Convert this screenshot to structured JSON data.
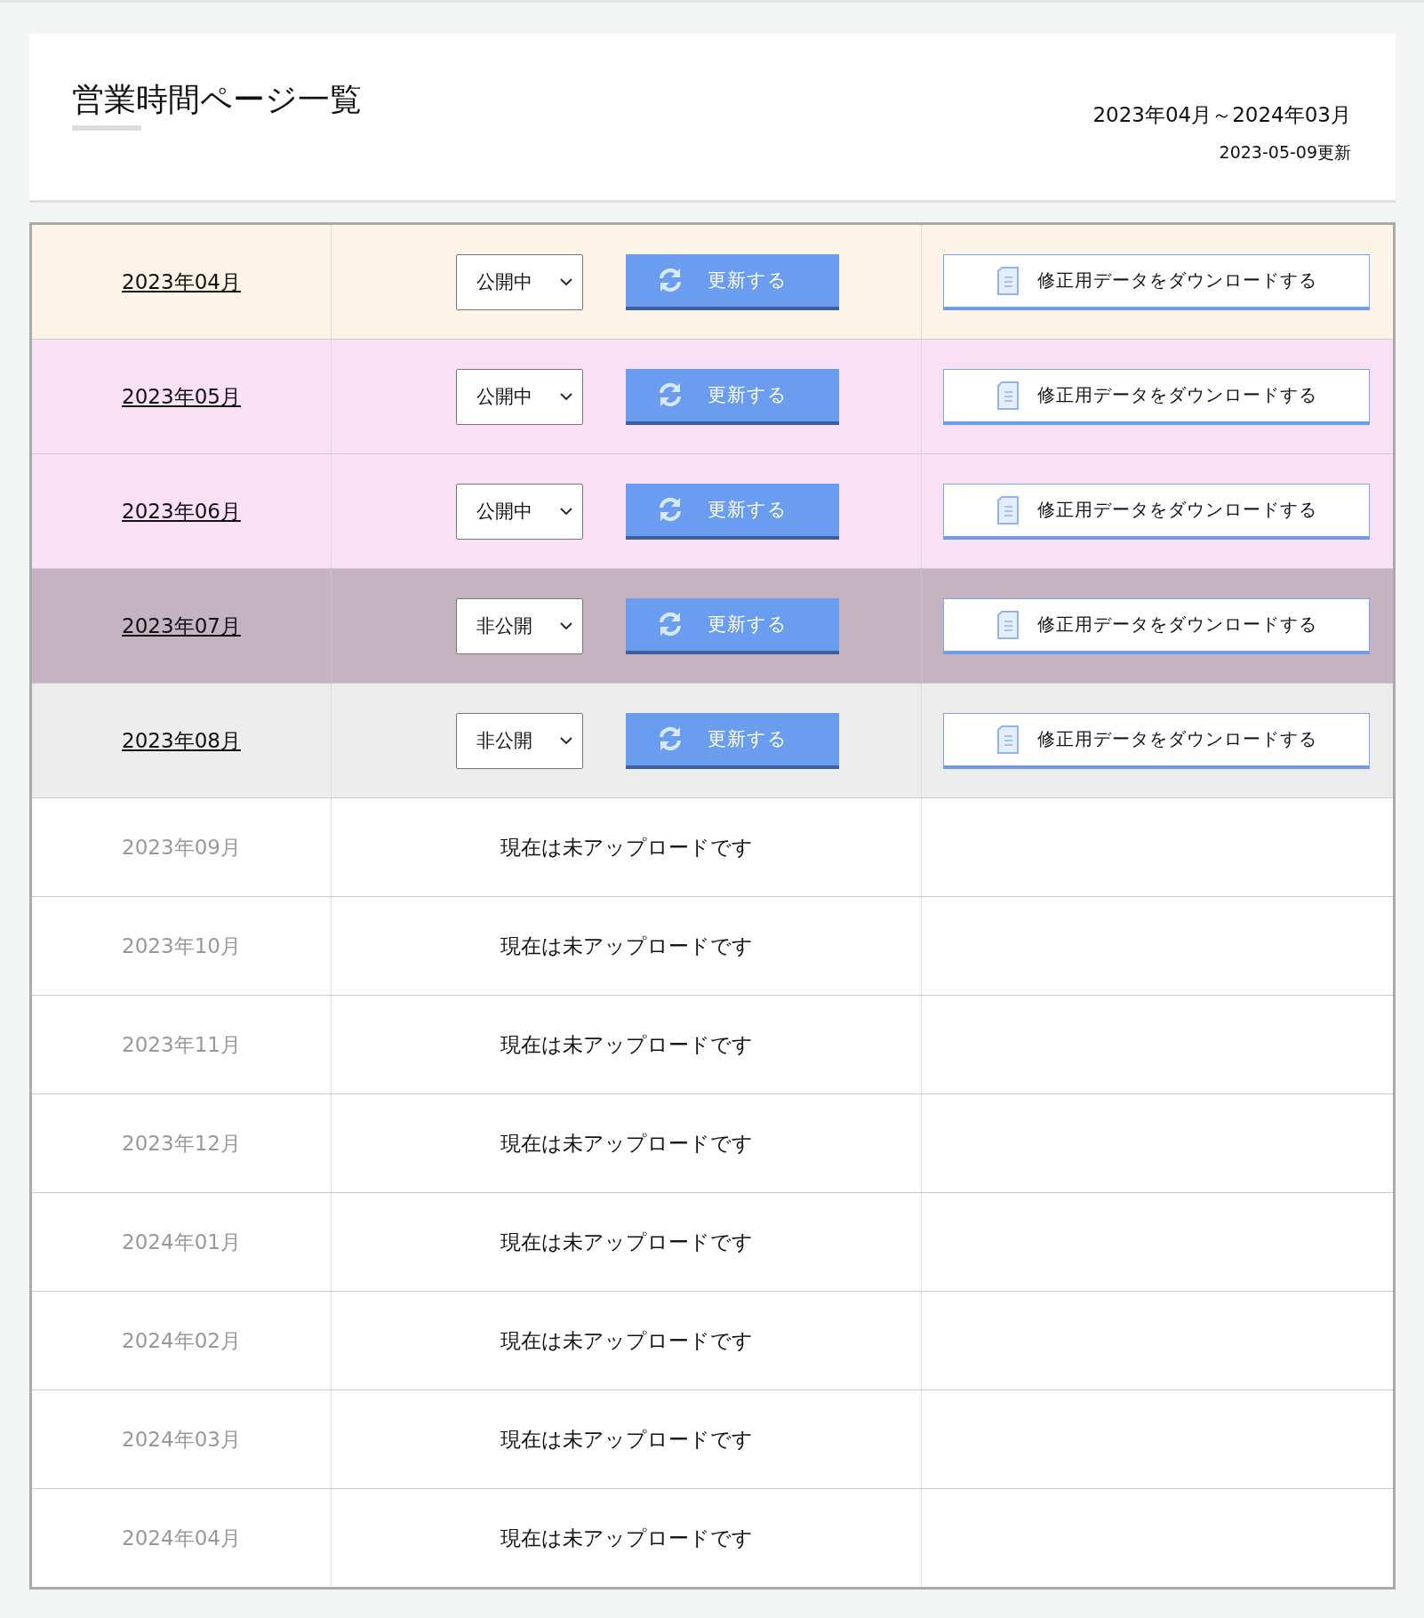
{
  "header": {
    "title": "営業時間ページ一覧",
    "period": "2023年04月～2024年03月",
    "updated": "2023-05-09更新"
  },
  "rows": [
    {
      "kind": "uploaded",
      "month": "2023年04月",
      "color": "#fcf4e6",
      "status": "公開中",
      "update_label": "更新する",
      "download_label": "修正用データをダウンロードする"
    },
    {
      "kind": "uploaded",
      "month": "2023年05月",
      "color": "#f9e0f4",
      "status": "公開中",
      "update_label": "更新する",
      "download_label": "修正用データをダウンロードする"
    },
    {
      "kind": "uploaded",
      "month": "2023年06月",
      "color": "#f9e0f4",
      "status": "公開中",
      "update_label": "更新する",
      "download_label": "修正用データをダウンロードする"
    },
    {
      "kind": "uploaded",
      "month": "2023年07月",
      "color": "#c4b4c2",
      "status": "非公開",
      "update_label": "更新する",
      "download_label": "修正用データをダウンロードする"
    },
    {
      "kind": "uploaded",
      "month": "2023年08月",
      "color": "#ececec",
      "status": "非公開",
      "update_label": "更新する",
      "download_label": "修正用データをダウンロードする"
    },
    {
      "kind": "pending",
      "month": "2023年09月",
      "message": "現在は未アップロードです"
    },
    {
      "kind": "pending",
      "month": "2023年10月",
      "message": "現在は未アップロードです"
    },
    {
      "kind": "pending",
      "month": "2023年11月",
      "message": "現在は未アップロードです"
    },
    {
      "kind": "pending",
      "month": "2023年12月",
      "message": "現在は未アップロードです"
    },
    {
      "kind": "pending",
      "month": "2024年01月",
      "message": "現在は未アップロードです"
    },
    {
      "kind": "pending",
      "month": "2024年02月",
      "message": "現在は未アップロードです"
    },
    {
      "kind": "pending",
      "month": "2024年03月",
      "message": "現在は未アップロードです"
    },
    {
      "kind": "pending",
      "month": "2024年04月",
      "message": "現在は未アップロードです"
    }
  ]
}
